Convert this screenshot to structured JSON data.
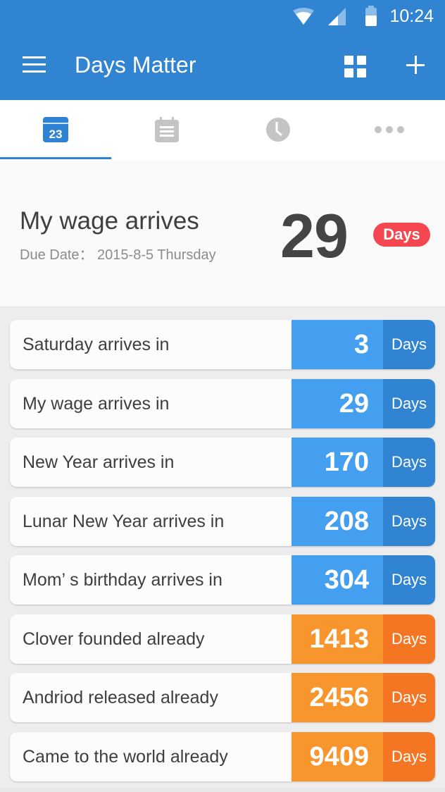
{
  "status_bar": {
    "time": "10:24",
    "icons": [
      "wifi-icon",
      "cell-signal-icon",
      "battery-icon"
    ]
  },
  "app_bar": {
    "title": "Days Matter",
    "menu_icon": "hamburger-menu-icon",
    "actions": [
      {
        "name": "grid-view",
        "icon": "grid-icon"
      },
      {
        "name": "add",
        "icon": "plus-icon"
      }
    ],
    "color": "#3184d1"
  },
  "tabs": [
    {
      "name": "calendar",
      "icon": "calendar-icon",
      "icon_text": "23",
      "active": true
    },
    {
      "name": "notes",
      "icon": "notepad-icon",
      "active": false
    },
    {
      "name": "history",
      "icon": "clock-icon",
      "active": false
    },
    {
      "name": "more",
      "icon": "more-dots-icon",
      "active": false
    }
  ],
  "featured": {
    "title": "My wage arrives",
    "subtitle": "Due Date： 2015-8-5 Thursday",
    "count": "29",
    "unit": "Days",
    "badge_color": "#f4474f"
  },
  "events": [
    {
      "label": "Saturday arrives in",
      "count": "3",
      "unit": "Days",
      "type": "future"
    },
    {
      "label": "My wage arrives in",
      "count": "29",
      "unit": "Days",
      "type": "future"
    },
    {
      "label": "New Year arrives in",
      "count": "170",
      "unit": "Days",
      "type": "future"
    },
    {
      "label": "Lunar New Year arrives in",
      "count": "208",
      "unit": "Days",
      "type": "future"
    },
    {
      "label": "Mom’ s birthday arrives in",
      "count": "304",
      "unit": "Days",
      "type": "future"
    },
    {
      "label": "Clover founded already",
      "count": "1413",
      "unit": "Days",
      "type": "past"
    },
    {
      "label": "Andriod released already",
      "count": "2456",
      "unit": "Days",
      "type": "past"
    },
    {
      "label": "Came to the world already",
      "count": "9409",
      "unit": "Days",
      "type": "past"
    }
  ],
  "colors": {
    "future_number": "#449ff0",
    "future_unit": "#3084d2",
    "past_number": "#f8962d",
    "past_unit": "#f47622"
  }
}
